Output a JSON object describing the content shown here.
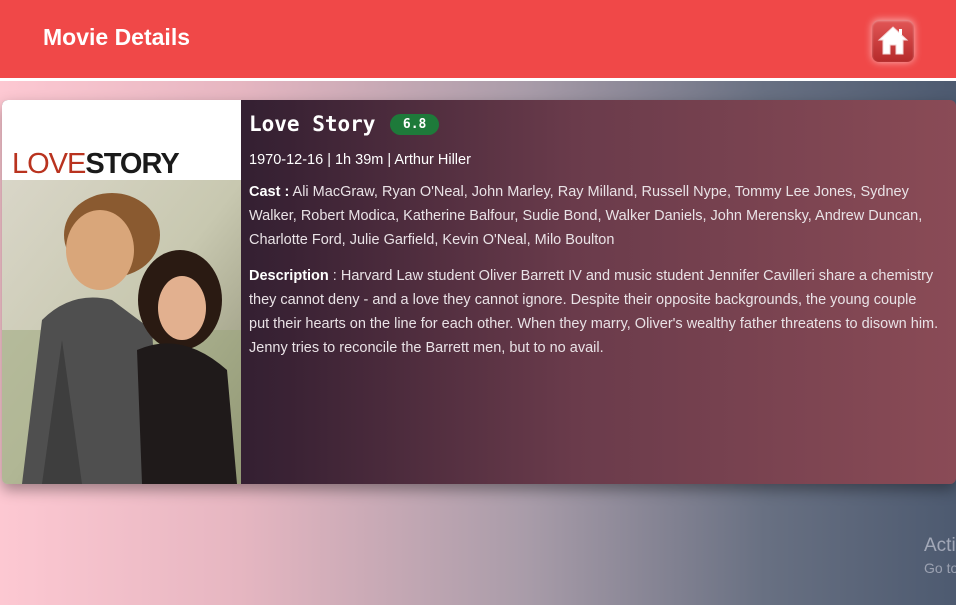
{
  "header": {
    "title": "Movie Details",
    "home_icon": "home-icon"
  },
  "movie": {
    "poster": {
      "title_love": "LOVE",
      "title_story": "STORY"
    },
    "title": "Love Story",
    "rating": "6.8",
    "meta": "1970-12-16 | 1h 39m | Arthur Hiller",
    "cast_label": "Cast :",
    "cast": "Ali MacGraw, Ryan O'Neal, John Marley, Ray Milland, Russell Nype, Tommy Lee Jones, Sydney Walker, Robert Modica, Katherine Balfour, Sudie Bond, Walker Daniels, John Merensky, Andrew Duncan, Charlotte Ford, Julie Garfield, Kevin O'Neal, Milo Boulton",
    "description_label": "Description",
    "description_separator": ":",
    "description": "Harvard Law student Oliver Barrett IV and music student Jennifer Cavilleri share a chemistry they cannot deny - and a love they cannot ignore. Despite their opposite backgrounds, the young couple put their hearts on the line for each other. When they marry, Oliver's wealthy father threatens to disown him. Jenny tries to reconcile the Barrett men, but to no avail."
  },
  "watermark": {
    "line1": "Acti",
    "line2": "Go to"
  },
  "colors": {
    "navbar": "#f04848",
    "rating_badge": "#1e7a3a"
  }
}
